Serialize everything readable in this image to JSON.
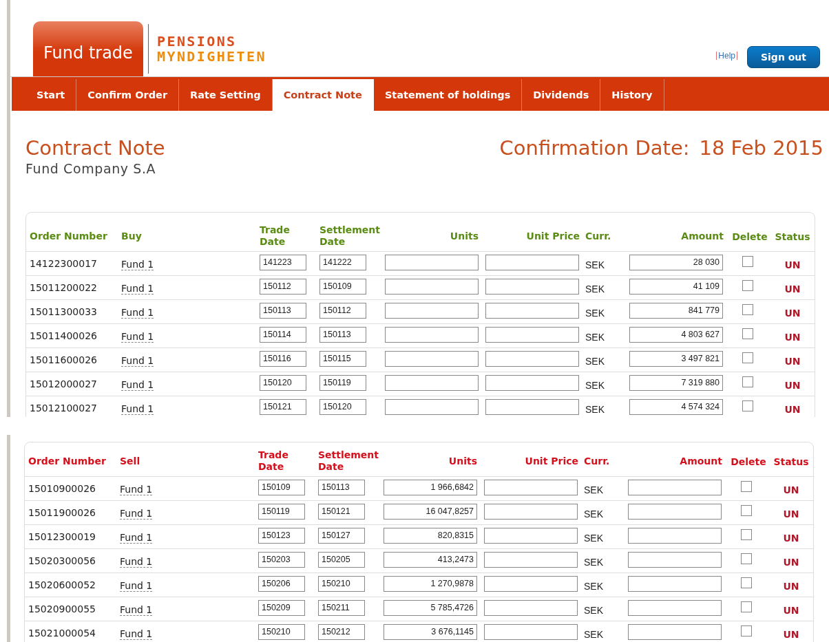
{
  "header": {
    "app_title": "Fund trade",
    "logo": {
      "line_1": "PENSIONS",
      "line_2": "MYNDIGHETEN"
    },
    "help_link": "Help",
    "sign_out": "Sign out"
  },
  "nav": [
    {
      "label": "Start",
      "selected": false
    },
    {
      "label": "Confirm Order",
      "selected": false
    },
    {
      "label": "Rate Setting",
      "selected": false
    },
    {
      "label": "Contract Note",
      "selected": true
    },
    {
      "label": "Statement of holdings",
      "selected": false
    },
    {
      "label": "Dividends",
      "selected": false
    },
    {
      "label": "History",
      "selected": false
    }
  ],
  "title": "Contract Note",
  "subtitle": "Fund Company S.A",
  "confirmation": {
    "label": "Confirmation Date:",
    "date": "18 Feb 2015"
  },
  "tables": [
    {
      "kind": "buy",
      "columns": [
        "Order Number",
        "Buy",
        "Trade Date",
        "Settlement Date",
        "Units",
        "Unit Price",
        "Curr.",
        "Amount",
        "Delete",
        "Status"
      ],
      "rows": [
        {
          "order_number": "14122300017",
          "fund": "Fund 1",
          "trade_date": "141223",
          "settlement_date": "141222",
          "currency": "SEK",
          "amount": "28 030",
          "delete": false,
          "status": "UN"
        },
        {
          "order_number": "15011200022",
          "fund": "Fund 1",
          "trade_date": "150112",
          "settlement_date": "150109",
          "currency": "SEK",
          "amount": "41 109",
          "delete": false,
          "status": "UN"
        },
        {
          "order_number": "15011300033",
          "fund": "Fund 1",
          "trade_date": "150113",
          "settlement_date": "150112",
          "currency": "SEK",
          "amount": "841 779",
          "delete": false,
          "status": "UN"
        },
        {
          "order_number": "15011400026",
          "fund": "Fund 1",
          "trade_date": "150114",
          "settlement_date": "150113",
          "currency": "SEK",
          "amount": "4 803 627",
          "delete": false,
          "status": "UN"
        },
        {
          "order_number": "15011600026",
          "fund": "Fund 1",
          "trade_date": "150116",
          "settlement_date": "150115",
          "currency": "SEK",
          "amount": "3 497 821",
          "delete": false,
          "status": "UN"
        },
        {
          "order_number": "15012000027",
          "fund": "Fund 1",
          "trade_date": "150120",
          "settlement_date": "150119",
          "currency": "SEK",
          "amount": "7 319 880",
          "delete": false,
          "status": "UN"
        },
        {
          "order_number": "15012100027",
          "fund": "Fund 1",
          "trade_date": "150121",
          "settlement_date": "150120",
          "currency": "SEK",
          "amount": "4 574 324",
          "delete": false,
          "status": "UN"
        }
      ]
    },
    {
      "kind": "sell",
      "columns": [
        "Order Number",
        "Sell",
        "Trade Date",
        "Settlement Date",
        "Units",
        "Unit Price",
        "Curr.",
        "Amount",
        "Delete",
        "Status"
      ],
      "rows": [
        {
          "order_number": "15010900026",
          "fund": "Fund 1",
          "trade_date": "150109",
          "settlement_date": "150113",
          "units": "1 966,6842",
          "currency": "SEK",
          "delete": false,
          "status": "UN"
        },
        {
          "order_number": "15011900026",
          "fund": "Fund 1",
          "trade_date": "150119",
          "settlement_date": "150121",
          "units": "16 047,8257",
          "currency": "SEK",
          "delete": false,
          "status": "UN"
        },
        {
          "order_number": "15012300019",
          "fund": "Fund 1",
          "trade_date": "150123",
          "settlement_date": "150127",
          "units": "820,8315",
          "currency": "SEK",
          "delete": false,
          "status": "UN"
        },
        {
          "order_number": "15020300056",
          "fund": "Fund 1",
          "trade_date": "150203",
          "settlement_date": "150205",
          "units": "413,2473",
          "currency": "SEK",
          "delete": false,
          "status": "UN"
        },
        {
          "order_number": "15020600052",
          "fund": "Fund 1",
          "trade_date": "150206",
          "settlement_date": "150210",
          "units": "1 270,9878",
          "currency": "SEK",
          "delete": false,
          "status": "UN"
        },
        {
          "order_number": "15020900055",
          "fund": "Fund 1",
          "trade_date": "150209",
          "settlement_date": "150211",
          "units": "5 785,4726",
          "currency": "SEK",
          "delete": false,
          "status": "UN"
        },
        {
          "order_number": "15021000054",
          "fund": "Fund 1",
          "trade_date": "150210",
          "settlement_date": "150212",
          "units": "3 676,1145",
          "currency": "SEK",
          "delete": false,
          "status": "UN"
        }
      ]
    }
  ]
}
